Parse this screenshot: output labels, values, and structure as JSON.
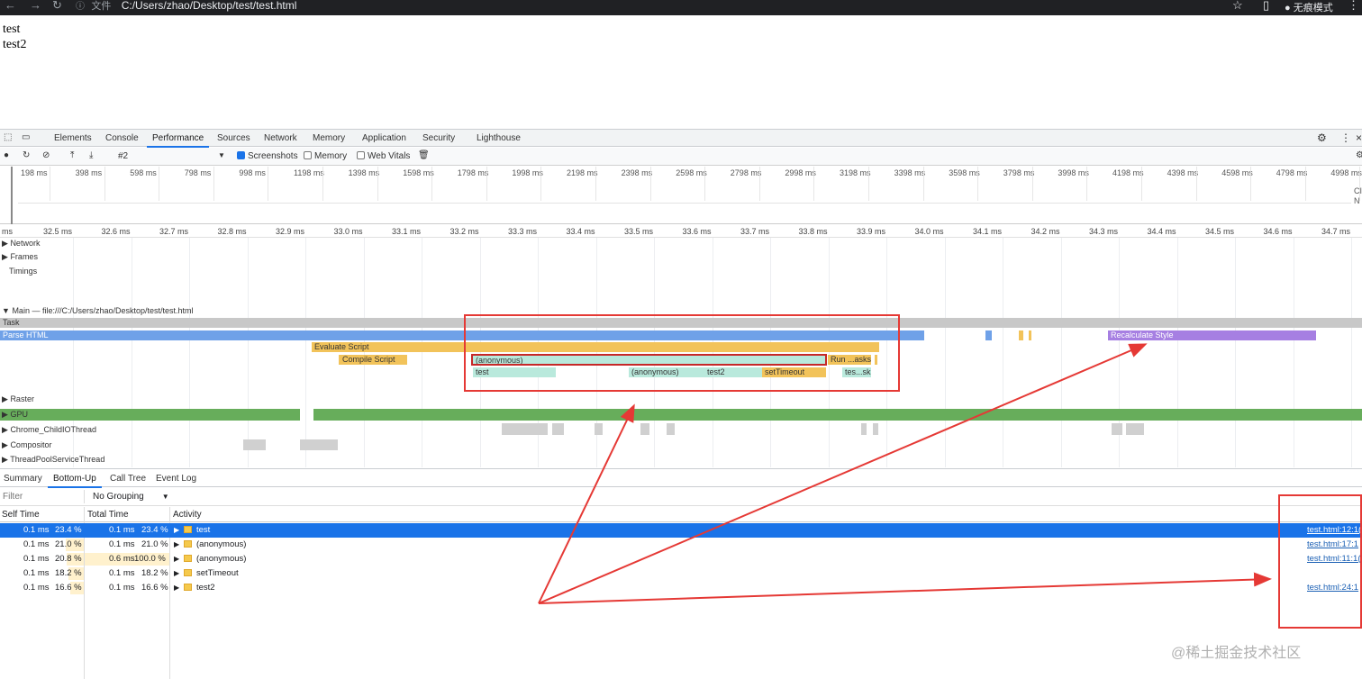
{
  "browser": {
    "url_label": "文件",
    "url": "C:/Users/zhao/Desktop/test/test.html",
    "incognito_label": "无痕模式"
  },
  "page": {
    "lines": [
      "test",
      "test2"
    ]
  },
  "devtools": {
    "tabs": [
      "Elements",
      "Console",
      "Performance",
      "Sources",
      "Network",
      "Memory",
      "Application",
      "Security",
      "Lighthouse"
    ],
    "active_tab": "Performance",
    "toolbar": {
      "recording_select": "#2",
      "screenshots_label": "Screenshots",
      "memory_label": "Memory",
      "webvitals_label": "Web Vitals"
    },
    "overview_ticks": [
      "198 ms",
      "398 ms",
      "598 ms",
      "798 ms",
      "998 ms",
      "1198 ms",
      "1398 ms",
      "1598 ms",
      "1798 ms",
      "1998 ms",
      "2198 ms",
      "2398 ms",
      "2598 ms",
      "2798 ms",
      "2998 ms",
      "3198 ms",
      "3398 ms",
      "3598 ms",
      "3798 ms",
      "3998 ms",
      "4198 ms",
      "4398 ms",
      "4598 ms",
      "4798 ms",
      "4998 ms"
    ],
    "overview_side": [
      "CI",
      "N"
    ],
    "ruler_ticks": [
      "ms",
      "32.5 ms",
      "32.6 ms",
      "32.7 ms",
      "32.8 ms",
      "32.9 ms",
      "33.0 ms",
      "33.1 ms",
      "33.2 ms",
      "33.3 ms",
      "33.4 ms",
      "33.5 ms",
      "33.6 ms",
      "33.7 ms",
      "33.8 ms",
      "33.9 ms",
      "34.0 ms",
      "34.1 ms",
      "34.2 ms",
      "34.3 ms",
      "34.4 ms",
      "34.5 ms",
      "34.6 ms",
      "34.7 ms"
    ],
    "tracks": {
      "network": "Network",
      "frames": "Frames",
      "timings": "Timings",
      "main": "Main — file:///C:/Users/zhao/Desktop/test/test.html",
      "raster": "Raster",
      "gpu": "GPU",
      "childio": "Chrome_ChildIOThread",
      "compositor": "Compositor",
      "threadpool": "ThreadPoolServiceThread"
    },
    "flame": {
      "task": "Task",
      "parse_html": "Parse HTML",
      "recalc_style": "Recalculate Style",
      "evaluate_script": "Evaluate Script",
      "compile_script": "Compile Script",
      "anonymous": "(anonymous)",
      "run_tasks": "Run ...asks",
      "test": "test",
      "anonymous2": "(anonymous)",
      "test2": "test2",
      "settimeout": "setTimeout",
      "tes_sk": "tes...sk"
    },
    "colors": {
      "task": "#c8c8c8",
      "parse_html": "#6fa1e8",
      "script": "#f2c35a",
      "js": "#b9e9dc",
      "style": "#a67fe2",
      "gpu": "#67ad5b",
      "annotation": "#e53935"
    },
    "bottom": {
      "tabs": [
        "Summary",
        "Bottom-Up",
        "Call Tree",
        "Event Log"
      ],
      "active_tab": "Bottom-Up",
      "filter_placeholder": "Filter",
      "grouping": "No Grouping",
      "headers": {
        "self": "Self Time",
        "total": "Total Time",
        "activity": "Activity"
      },
      "rows": [
        {
          "self": "0.1 ms",
          "self_pct": "23.4 %",
          "total": "0.1 ms",
          "total_pct": "23.4 %",
          "name": "test",
          "source": "test.html:12:1(",
          "selected": true
        },
        {
          "self": "0.1 ms",
          "self_pct": "21.0 %",
          "total": "0.1 ms",
          "total_pct": "21.0 %",
          "name": "(anonymous)",
          "source": "test.html:17:1",
          "selected": false
        },
        {
          "self": "0.1 ms",
          "self_pct": "20.8 %",
          "total": "0.6 ms",
          "total_pct": "100.0 %",
          "name": "(anonymous)",
          "source": "test.html:11:1(",
          "selected": false
        },
        {
          "self": "0.1 ms",
          "self_pct": "18.2 %",
          "total": "0.1 ms",
          "total_pct": "18.2 %",
          "name": "setTimeout",
          "source": "",
          "selected": false
        },
        {
          "self": "0.1 ms",
          "self_pct": "16.6 %",
          "total": "0.1 ms",
          "total_pct": "16.6 %",
          "name": "test2",
          "source": "test.html:24:1",
          "selected": false
        }
      ]
    }
  },
  "watermark": "@稀土掘金技术社区"
}
